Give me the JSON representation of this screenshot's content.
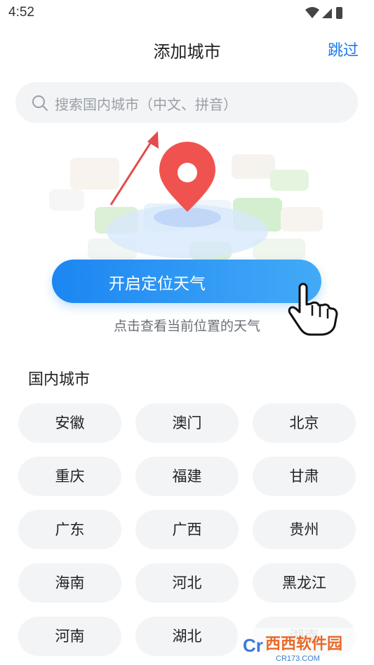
{
  "status_bar": {
    "time": "4:52"
  },
  "header": {
    "title": "添加城市",
    "skip_label": "跳过"
  },
  "search": {
    "placeholder": "搜索国内城市（中文、拼音）"
  },
  "locate": {
    "button_label": "开启定位天气",
    "hint": "点击查看当前位置的天气"
  },
  "domestic": {
    "section_title": "国内城市",
    "cities": [
      "安徽",
      "澳门",
      "北京",
      "重庆",
      "福建",
      "甘肃",
      "广东",
      "广西",
      "贵州",
      "海南",
      "河北",
      "黑龙江",
      "河南",
      "湖北",
      "湖南"
    ]
  },
  "colors": {
    "accent": "#1a7ae8",
    "chip_bg": "#f3f4f6",
    "pin": "#f0534f"
  },
  "watermark": {
    "brand": "西西软件园",
    "domain": "CR173.COM"
  }
}
